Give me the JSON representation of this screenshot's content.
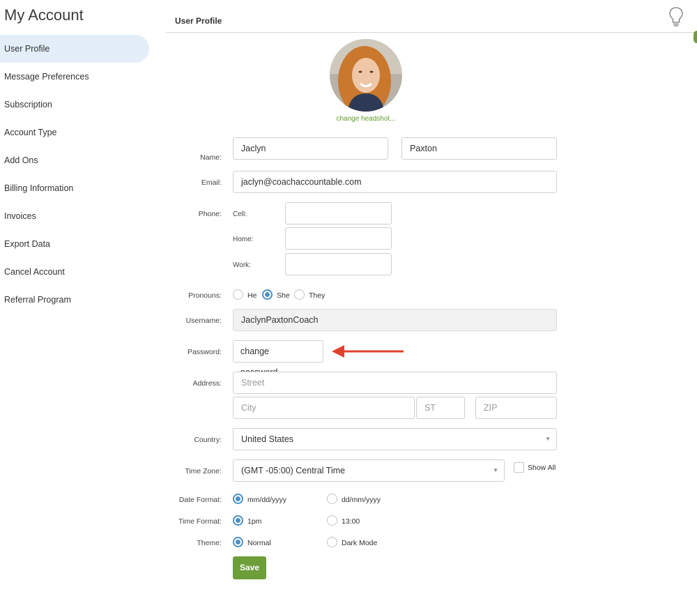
{
  "sidebar": {
    "title": "My Account",
    "items": [
      {
        "label": "User Profile",
        "active": true
      },
      {
        "label": "Message Preferences"
      },
      {
        "label": "Subscription"
      },
      {
        "label": "Account Type"
      },
      {
        "label": "Add Ons"
      },
      {
        "label": "Billing Information"
      },
      {
        "label": "Invoices"
      },
      {
        "label": "Export Data"
      },
      {
        "label": "Cancel Account"
      },
      {
        "label": "Referral Program"
      }
    ]
  },
  "header": {
    "title": "User Profile",
    "icon": "lightbulb-icon"
  },
  "profile": {
    "change_headshot": "change headshot..."
  },
  "form": {
    "name": {
      "label": "Name:",
      "first": "Jaclyn",
      "last": "Paxton"
    },
    "email": {
      "label": "Email:",
      "value": "jaclyn@coachaccountable.com"
    },
    "phone": {
      "label": "Phone:",
      "cell": {
        "label": "Cell:",
        "value": ""
      },
      "home": {
        "label": "Home:",
        "value": ""
      },
      "work": {
        "label": "Work:",
        "value": ""
      }
    },
    "pronouns": {
      "label": "Pronouns:",
      "options": [
        "He",
        "She",
        "They"
      ],
      "selected": "She"
    },
    "username": {
      "label": "Username:",
      "value": "JaclynPaxtonCoach"
    },
    "password": {
      "label": "Password:",
      "button": "change password..."
    },
    "address": {
      "label": "Address:",
      "street_placeholder": "Street",
      "city_placeholder": "City",
      "state_placeholder": "ST",
      "zip_placeholder": "ZIP"
    },
    "country": {
      "label": "Country:",
      "value": "United States"
    },
    "time_zone": {
      "label": "Time Zone:",
      "value": "(GMT -05:00) Central Time",
      "show_all": "Show All"
    },
    "date_format": {
      "label": "Date Format:",
      "options": [
        "mm/dd/yyyy",
        "dd/mm/yyyy"
      ],
      "selected": "mm/dd/yyyy"
    },
    "time_format": {
      "label": "Time Format:",
      "options": [
        "1pm",
        "13:00"
      ],
      "selected": "1pm"
    },
    "theme": {
      "label": "Theme:",
      "options": [
        "Normal",
        "Dark Mode"
      ],
      "selected": "Normal"
    },
    "save": "Save"
  },
  "colors": {
    "accent_green": "#6e9e3a",
    "radio_blue": "#4a90c8",
    "active_nav": "#e3eef8",
    "arrow_red": "#e0412f"
  }
}
